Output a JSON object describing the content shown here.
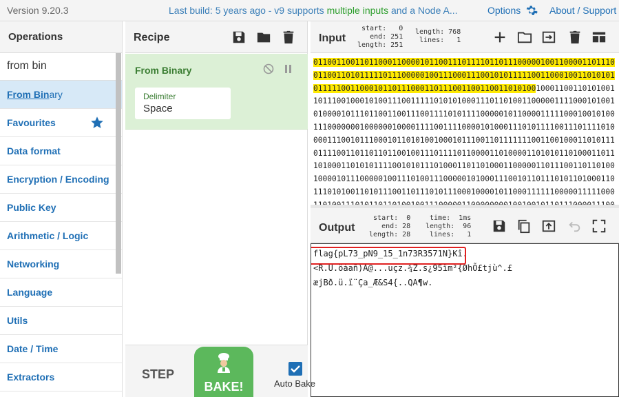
{
  "topbar": {
    "version": "Version 9.20.3",
    "build_prefix": "Last build: 5 years ago - v9 supports ",
    "build_highlight": "multiple inputs",
    "build_suffix": " and a Node A...",
    "options": "Options",
    "about": "About / Support"
  },
  "operations": {
    "title": "Operations",
    "search_value": "from bin",
    "search_result_prefix": "From Bin",
    "search_result_suffix": "ary",
    "categories": [
      "Favourites",
      "Data format",
      "Encryption / Encoding",
      "Public Key",
      "Arithmetic / Logic",
      "Networking",
      "Language",
      "Utils",
      "Date / Time",
      "Extractors"
    ]
  },
  "recipe": {
    "title": "Recipe",
    "operation": "From Binary",
    "delimiter_label": "Delimiter",
    "delimiter_value": "Space",
    "step_label": "STEP",
    "bake_label": "BAKE!",
    "auto_bake_label": "Auto Bake"
  },
  "input": {
    "title": "Input",
    "stats_left": "start:   0\nend: 251\nlength: 251",
    "stats_right": "length: 768\nlines:   1",
    "highlighted": "0110011001101100011000010110011101111011011100000100110000110111001100110101111101110000010011100011100101011111001100010011010101011111001100010110111000110111001100110011010100",
    "rest": "10001100110101001101110010001010011100111110101010001110110100110000011110001010010100001011101100110011100111101011110000010110000111110001001010011100000001000000100001111001111000010100011101011110011101111010000111001011100010110101001000101110011011111110011001000110101110111100110110110110010011101111011000011010000110101011010001101110100011010101111001010111010001101101000110000011011100110110100100001011100000100111010011100000101000111001011011101011010001101110101001101011100110111010111000100001011000111111000001111100011010011101011011010010011100000110000000010010010110111000011100000111100010001100011010011010110000110111000111100110100001011011001001101001100001001001110101001101100100111111011110001011100110001101101100100111"
  },
  "output": {
    "title": "Output",
    "stats_left": "start:  0\nend: 28\nlength: 28",
    "stats_right": "time:  1ms\nlength:  96\nlines:   1",
    "line1": "flag{pL73_pN9_15_1n73R3571N}Kî.",
    "line2": "<R.U.öáañ)A@...uçz.¾Z.s¿95îm²{ØhÕ£tjù^.£",
    "line3": "æjBð.ü.ï¨Ça_Æ&S4{..QA¶w."
  },
  "colors": {
    "accent": "#1f6fb5",
    "recipe_bg": "#dcf0d6",
    "bake": "#5cb85c",
    "highlight": "#ffea00",
    "flag_box": "#e02020"
  }
}
